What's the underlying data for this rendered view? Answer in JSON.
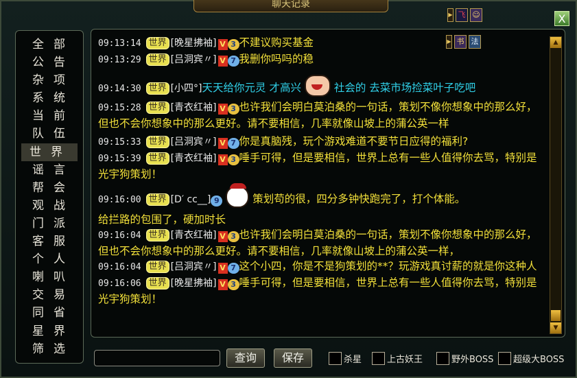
{
  "window": {
    "title": "聊天记录",
    "close_label": "X"
  },
  "sidebar": {
    "items": [
      "全部",
      "公告",
      "杂项",
      "系统",
      "当前",
      "队伍",
      "世界",
      "谣言",
      "帮会",
      "观战",
      "门派",
      "客服",
      "个人",
      "喇叭",
      "交易",
      "同省",
      "星界",
      "筛选"
    ],
    "active": "世界"
  },
  "messages": [
    {
      "time": "09:13:14",
      "channel": "世界",
      "name": "[晚星拂袖]",
      "vip": "V",
      "level": "3",
      "text": "不建议购买基金"
    },
    {
      "time": "09:13:29",
      "channel": "世界",
      "name": "[吕洞宾〃]",
      "vip": "V",
      "level": "7",
      "text": "我删你吗吗的稳"
    },
    {
      "time": "09:14:30",
      "channel": "世界",
      "name": "[小四°]",
      "text": "天天给你元灵  才高兴",
      "text2": "社会的  去菜市场捡菜叶子吃吧"
    },
    {
      "time": "09:15:28",
      "channel": "世界",
      "name": "[青衣红袖]",
      "vip": "V",
      "level": "3",
      "text": "也许我们会明白莫泊桑的一句话，策划不像你想象中的那么好，但也不会你想象中的那么更好。请不要相信，几率就像山坡上的蒲公英一样"
    },
    {
      "time": "09:15:33",
      "channel": "世界",
      "name": "[吕洞宾〃]",
      "vip": "V",
      "level": "7",
      "text": "你是真脑残，玩个游戏难道不要节日应得的福利?"
    },
    {
      "time": "09:15:39",
      "channel": "世界",
      "name": "[青衣红袖]",
      "vip": "V",
      "level": "3",
      "text": "唾手可得，但是要相信，世界上总有一些人值得你去骂，特别是光宇狗策划！"
    },
    {
      "time": "09:16:00",
      "channel": "世界",
      "name": "[D′ cc__]",
      "level": "9",
      "text": "策划苟的很，四分多钟快跑完了，打个体能。",
      "text2": "给拦路的包围了，硬加时长"
    },
    {
      "time": "09:16:04",
      "channel": "世界",
      "name": "[青衣红袖]",
      "vip": "V",
      "level": "3",
      "text": "也许我们会明白莫泊桑的一句话，策划不像你想象中的那么好，但也不会你想象中的那么更好。请不要相信，几率就像山坡上的蒲公英一样，"
    },
    {
      "time": "09:16:04",
      "channel": "世界",
      "name": "[吕洞宾〃]",
      "vip": "V",
      "level": "7",
      "text": "这个小四，你是不是狗策划的**？玩游戏真讨薪的就是你这种人"
    },
    {
      "time": "09:16:06",
      "channel": "世界",
      "name": "[晚星拂袖]",
      "vip": "V",
      "level": "3",
      "text": "唾手可得，但是要相信，世界上总有一些人值得你去骂，特别是光宇狗策划！"
    }
  ],
  "bottom": {
    "search_label": "查询",
    "save_label": "保存",
    "filters": [
      "杀星",
      "上古妖王",
      "野外BOSS",
      "超级大BOSS"
    ]
  },
  "colors": {
    "chat_text": "#f2e03a",
    "cyan_text": "#30d0e8",
    "timestamp": "#e8e8e8"
  }
}
